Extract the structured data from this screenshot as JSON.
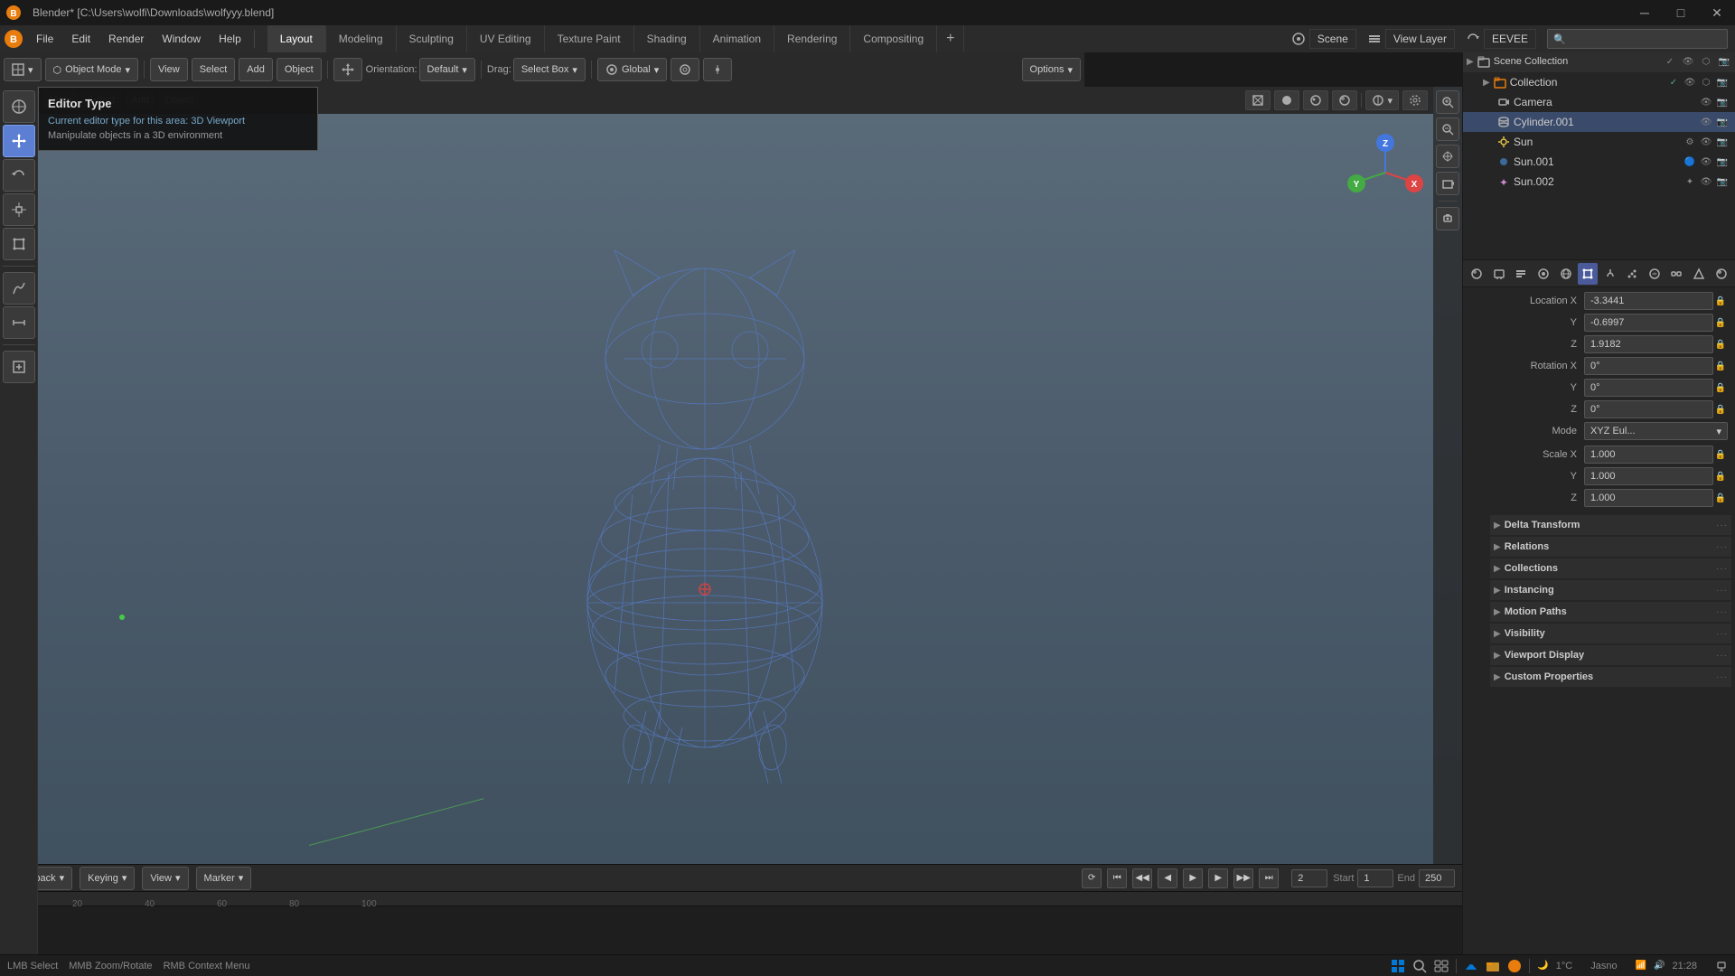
{
  "titlebar": {
    "title": "Blender* [C:\\Users\\wolfi\\Downloads\\wolfyyy.blend]",
    "minimize": "─",
    "maximize": "□",
    "close": "✕"
  },
  "menubar": {
    "logo": "🔵",
    "menus": [
      "File",
      "Edit",
      "Render",
      "Window",
      "Help"
    ],
    "workspaces": [
      "Layout",
      "Modeling",
      "Sculpting",
      "UV Editing",
      "Texture Paint",
      "Shading",
      "Animation",
      "Rendering",
      "Compositing"
    ],
    "active_workspace": "Layout",
    "scene": "Scene",
    "view_layer": "View Layer"
  },
  "toolbar": {
    "editor_icon": "🔲",
    "move_icon": "⊕",
    "orientation_label": "Orientation:",
    "orientation_value": "Default",
    "drag_label": "Drag:",
    "drag_value": "Select Box",
    "global_value": "Global",
    "options_label": "Options"
  },
  "left_tools": [
    "cursor",
    "move",
    "rotate",
    "scale",
    "transform",
    "annotate",
    "measure",
    "add_cube"
  ],
  "viewport": {
    "header_items": [
      "viewport_shading_wire",
      "viewport_shading_solid",
      "viewport_shading_material",
      "viewport_shading_render"
    ]
  },
  "tooltip": {
    "title": "Editor Type",
    "subtitle_label": "Current editor type for this area:",
    "subtitle_value": "3D Viewport",
    "description": "Manipulate objects in a 3D environment"
  },
  "outliner": {
    "title": "Scene Collection",
    "items": [
      {
        "name": "Collection",
        "indent": 1,
        "icon": "📁",
        "type": "collection"
      },
      {
        "name": "Camera",
        "indent": 2,
        "icon": "📷",
        "type": "camera"
      },
      {
        "name": "Cylinder.001",
        "indent": 2,
        "icon": "⬡",
        "type": "mesh"
      },
      {
        "name": "Sun",
        "indent": 2,
        "icon": "☀",
        "type": "light"
      },
      {
        "name": "Sun.001",
        "indent": 2,
        "icon": "🔵",
        "type": "light"
      },
      {
        "name": "Sun.002",
        "indent": 2,
        "icon": "✦",
        "type": "light"
      }
    ]
  },
  "properties": {
    "location": {
      "label": "Location X",
      "x": "-3.3441",
      "y": "-0.6997",
      "z": "1.9182"
    },
    "rotation": {
      "label": "Rotation X",
      "x": "0°",
      "y": "0°",
      "z": "0°",
      "mode": "XYZ Eul..."
    },
    "scale": {
      "label": "Scale X",
      "x": "1.000",
      "y": "1.000",
      "z": "1.000"
    },
    "sections": [
      "Delta Transform",
      "Relations",
      "Collections",
      "Instancing",
      "Motion Paths",
      "Visibility",
      "Viewport Display",
      "Custom Properties"
    ]
  },
  "timeline": {
    "playback_label": "Playback",
    "keying_label": "Keying",
    "view_label": "View",
    "marker_label": "Marker",
    "frame_current": "2",
    "start_label": "Start",
    "start_value": "1",
    "end_label": "End",
    "end_value": "250"
  },
  "statusbar": {
    "temp": "1°C",
    "location": "Jasno",
    "time": "21:28"
  },
  "axes": {
    "z": "Z",
    "x": "X",
    "y": "Y"
  }
}
